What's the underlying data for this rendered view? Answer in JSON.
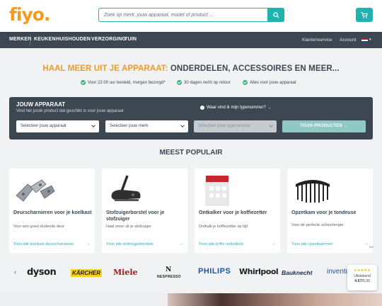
{
  "header": {
    "logo": "fiyo.",
    "search_placeholder": "Zoek op merk, jouw apparaat, model of product ...",
    "search_icon": "search-icon",
    "cart_icon": "cart-icon"
  },
  "nav": {
    "items": [
      "MERKEN",
      "KEUKEN",
      "HUISHOUDEN",
      "VERZORGING",
      "TUIN"
    ],
    "service": "Klantenservice",
    "account": "Account",
    "language_icon": "dutch-flag-icon"
  },
  "hero": {
    "headline_accent": "HAAL MEER UIT JE APPARAAT:",
    "headline_rest": " ONDERDELEN, ACCESSOIRES EN MEER...",
    "usps": [
      "Voor 22:00 uur besteld, morgen bezorgd*",
      "30 dagen recht op retour",
      "Alles voor jouw apparaat"
    ]
  },
  "finder": {
    "title": "JOUW APPARAAT",
    "subtitle": "Vind het juiste product dat geschikt is voor jouw apparaat",
    "help": "Waar vind ik mijn typenummer?",
    "select_device": "Selecteer jouw apparaat",
    "select_brand": "Selecteer jouw merk",
    "select_type": "Selecteer jouw typenummer",
    "button": "TOON PRODUCTEN →"
  },
  "popular": {
    "title": "MEEST POPULAIR",
    "cards": [
      {
        "title": "Deurscharnieren voor je koelkast",
        "desc": "Voor een goed sluitende deur",
        "link": "Toon alle koelkast deurscharnieren"
      },
      {
        "title": "Stofzuigerborstel voor je stofzuiger",
        "desc": "Haal meer uit je stofzuiger",
        "link": "Toon alle stofzuigerborstels"
      },
      {
        "title": "Ontkalker voor je koffiezetter",
        "desc": "Ontkalk je koffiezetter op tijd",
        "link": "Toon alle koffie ontkalkers"
      },
      {
        "title": "Opzetkam voor je tondeuse",
        "desc": "Voor de perfecte scheerlengte",
        "link": "Toon alle opzetkammen"
      }
    ],
    "dots": "•••"
  },
  "brands": {
    "items": [
      "dyson",
      "KÄRCHER",
      "Miele",
      "NESPRESSO",
      "PHILIPS",
      "Whirlpool",
      "Bauknecht",
      "inventum"
    ],
    "prev_icon": "chevron-left-icon"
  },
  "rating": {
    "stars": "★★★★★",
    "label": "Uitstekend",
    "score": "4.67",
    "scale": "/5.00"
  },
  "colors": {
    "brand_orange": "#f39a1f",
    "teal": "#1fb3b0",
    "navy": "#3d4752"
  }
}
